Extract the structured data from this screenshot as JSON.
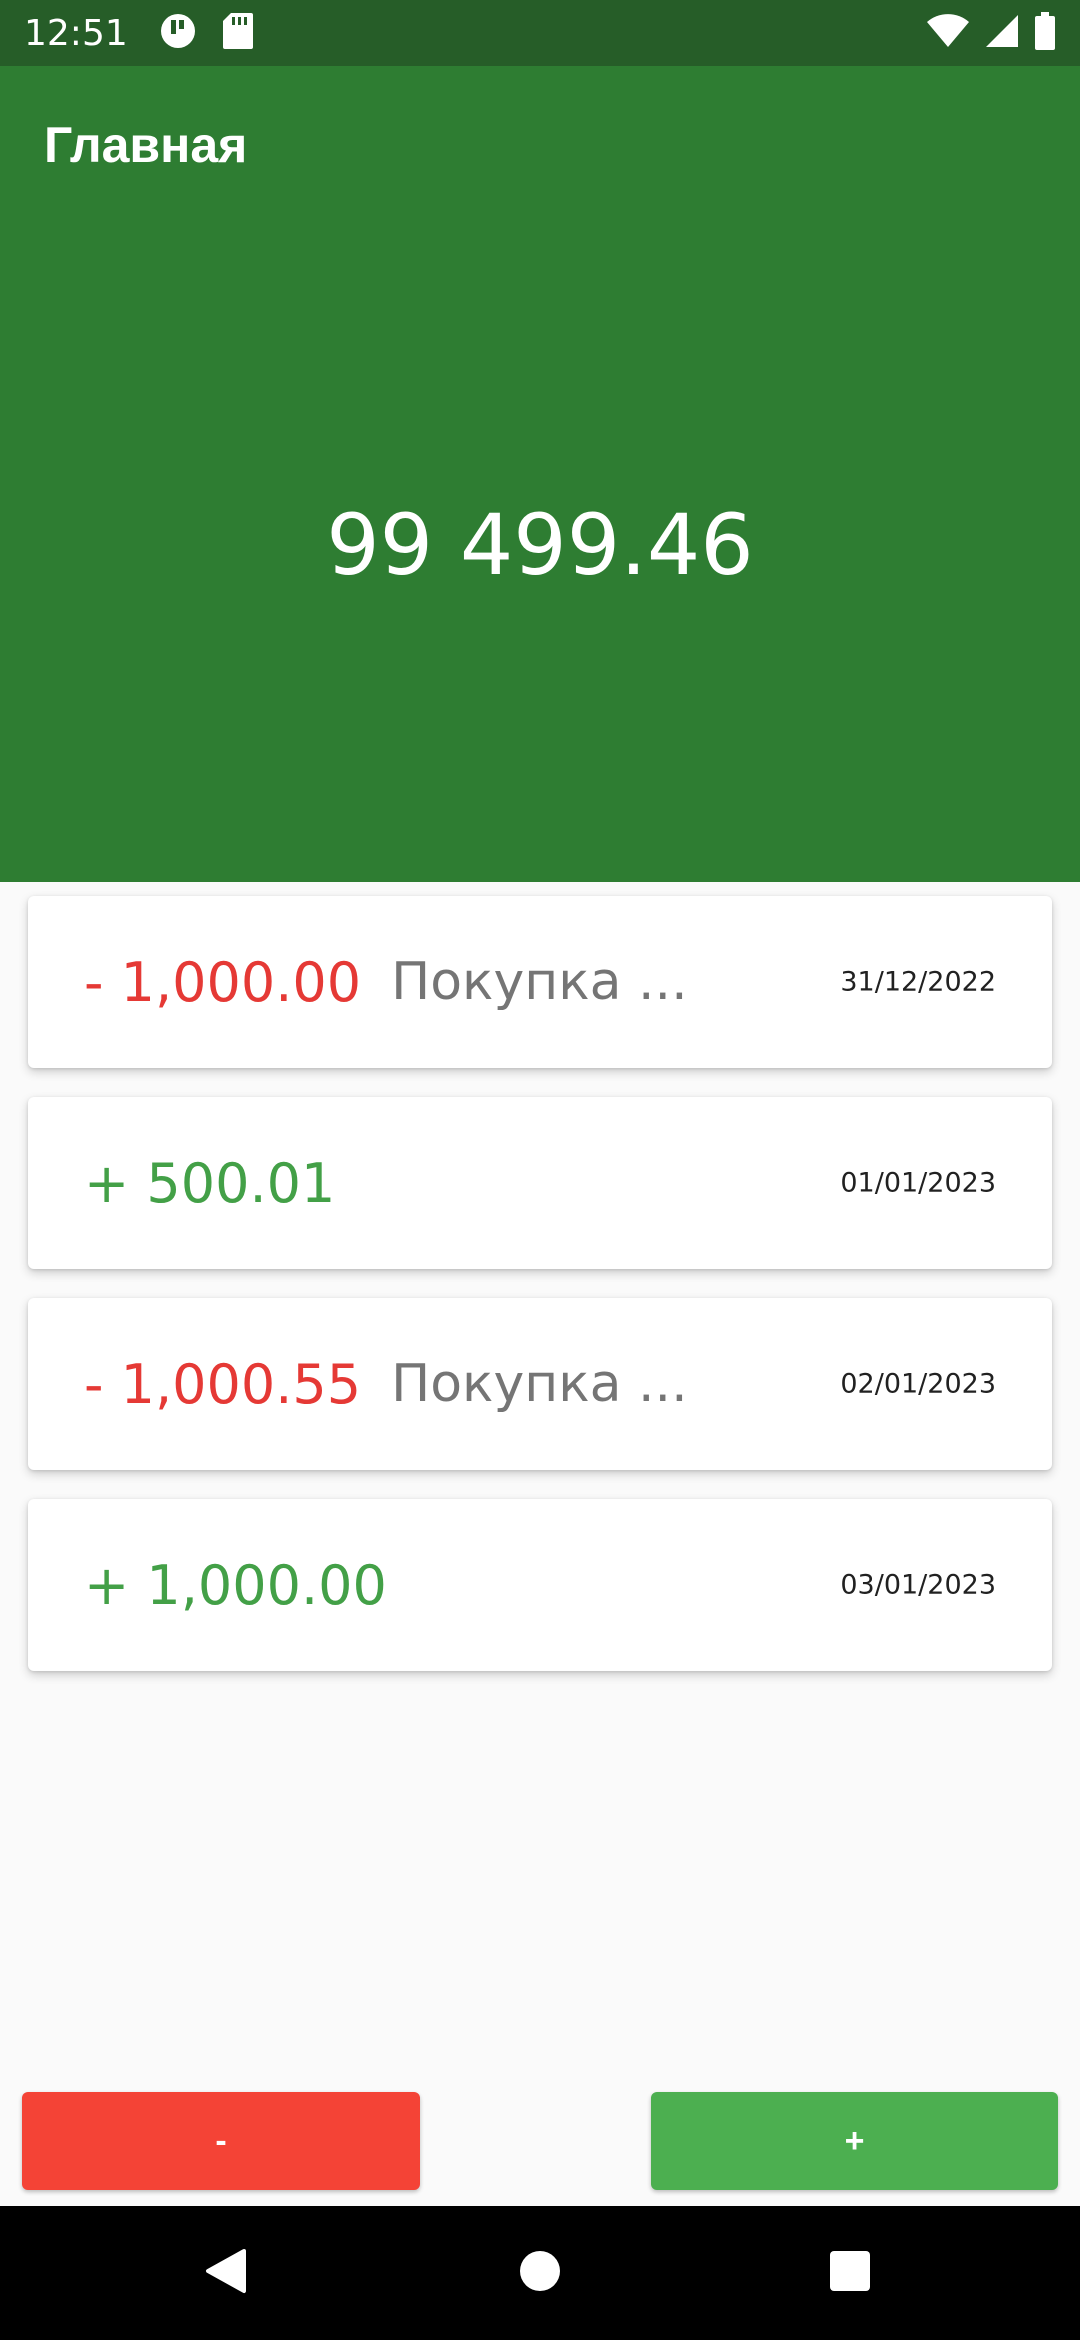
{
  "status_bar": {
    "time": "12:51"
  },
  "app_bar": {
    "title": "Главная"
  },
  "balance": {
    "value": "99 499.46"
  },
  "transactions": [
    {
      "amount": "- 1,000.00",
      "description": "Покупка ...",
      "date": "31/12/2022",
      "type": "expense"
    },
    {
      "amount": "+ 500.01",
      "description": "",
      "date": "01/01/2023",
      "type": "income"
    },
    {
      "amount": "- 1,000.55",
      "description": "Покупка ...",
      "date": "02/01/2023",
      "type": "expense"
    },
    {
      "amount": "+ 1,000.00",
      "description": "",
      "date": "03/01/2023",
      "type": "income"
    }
  ],
  "actions": {
    "minus_label": "-",
    "plus_label": "+"
  },
  "colors": {
    "header_green": "#2e7d32",
    "status_bar_green": "#265d28",
    "expense_red": "#e53935",
    "income_green": "#43a047",
    "minus_button_red": "#f44336",
    "plus_button_green": "#4caf50"
  },
  "icons": {
    "status_left": [
      "data-saver-icon",
      "sd-card-icon"
    ],
    "status_right": [
      "wifi-icon",
      "signal-icon",
      "battery-icon"
    ],
    "nav": [
      "back-icon",
      "home-icon",
      "recents-icon"
    ]
  }
}
